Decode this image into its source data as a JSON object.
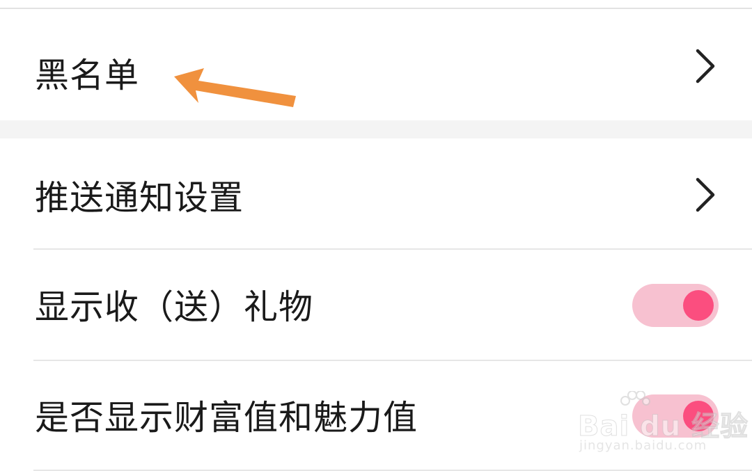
{
  "settings": {
    "rows": [
      {
        "label": "黑名单",
        "control": "chevron"
      },
      {
        "label": "推送通知设置",
        "control": "chevron"
      },
      {
        "label": "显示收（送）礼物",
        "control": "toggle",
        "enabled": true
      },
      {
        "label": "是否显示财富值和魅力值",
        "control": "toggle",
        "enabled": true
      }
    ]
  },
  "colors": {
    "accent": "#fb4e7f",
    "toggle_track": "#f7c1d0",
    "annotation_arrow": "#f0913e",
    "text": "#1a1a1a",
    "section_gap": "#f4f4f4"
  },
  "watermark": {
    "brand": "Bai du 经验",
    "url": "jingyan.baidu.com"
  }
}
